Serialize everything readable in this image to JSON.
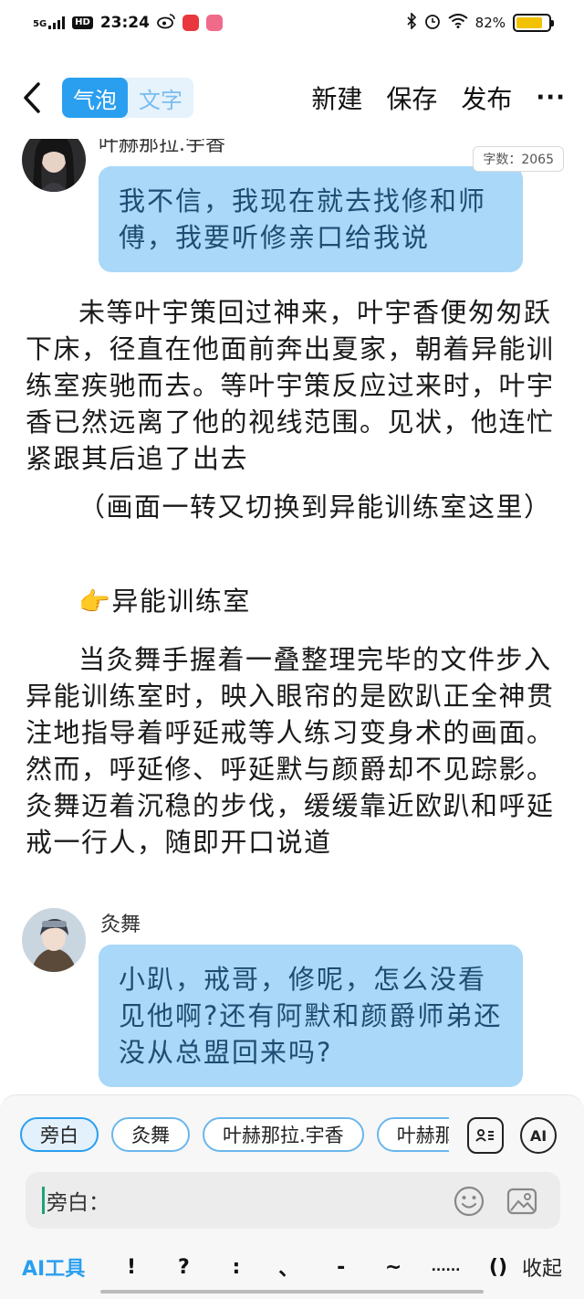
{
  "status_bar": {
    "network": "5G",
    "hd": "HD",
    "time": "23:24",
    "battery_percent": "82%",
    "battery_level": 0.82,
    "colors": {
      "battery_fill": "#f2c200"
    },
    "icons": [
      "signal-icon",
      "weibo-icon",
      "app-icon",
      "bilibili-icon",
      "bluetooth-icon",
      "alarm-icon",
      "wifi-icon",
      "battery-icon"
    ]
  },
  "toolbar": {
    "mode_bubble": "气泡",
    "mode_text": "文字",
    "new_label": "新建",
    "save_label": "保存",
    "publish_label": "发布",
    "more_label": "···",
    "colors": {
      "accent": "#2a9ff0"
    }
  },
  "content": {
    "word_count": "字数：2065",
    "speaker1_name": "叶赫那拉.宇香",
    "bubble1_text": "我不信，我现在就去找修和师傅，我要听修亲口给我说",
    "para1": "未等叶宇策回过神来，叶宇香便匆匆跃下床，径直在他面前奔出夏家，朝着异能训练室疾驰而去。等叶宇策反应过来时，叶宇香已然远离了他的视线范围。见状，他连忙紧跟其后追了出去",
    "para2": "（画面一转又切换到异能训练室这里）",
    "pointer_emoji": "👉",
    "scene_heading": "异能训练室",
    "para3": "当灸舞手握着一叠整理完毕的文件步入异能训练室时，映入眼帘的是欧趴正全神贯注地指导着呼延戒等人练习变身术的画面。然而，呼延修、呼延默与颜爵却不见踪影。灸舞迈着沉稳的步伐，缓缓靠近欧趴和呼延戒一行人，随即开口说道",
    "speaker2_name": "灸舞",
    "bubble2_text": "小趴，戒哥，修呢，怎么没看见他啊?还有阿默和颜爵师弟还没从总盟回来吗?",
    "colors": {
      "bubble": "#a9d8f8"
    }
  },
  "bottom": {
    "chips": [
      "旁白",
      "灸舞",
      "叶赫那拉.宇香",
      "叶赫那拉.宇策"
    ],
    "active_chip": "旁白",
    "ai_icon_label": "AI",
    "input_prefix": "旁白：",
    "ai_tools_label": "AI工具",
    "symbols": [
      "!",
      "?",
      ":",
      "、",
      "-",
      "~",
      "......",
      "()"
    ],
    "collapse_label": "收起"
  }
}
